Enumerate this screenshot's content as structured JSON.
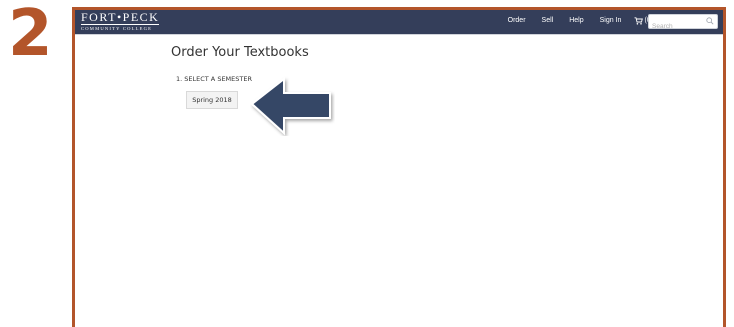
{
  "step": {
    "number": "2"
  },
  "header": {
    "logo": {
      "name": "FORT•PECK",
      "subtitle": "COMMUNITY COLLEGE"
    },
    "nav": [
      {
        "label": "Order"
      },
      {
        "label": "Sell"
      },
      {
        "label": "Help"
      },
      {
        "label": "Sign In"
      }
    ],
    "cart": {
      "label": "(0)",
      "icon": "cart-icon"
    },
    "search": {
      "placeholder": "Search",
      "icon": "search-icon"
    }
  },
  "main": {
    "title": "Order Your Textbooks",
    "step_label": "1. SELECT A SEMESTER",
    "semester_option": "Spring 2018"
  },
  "colors": {
    "frame_border": "#b3552a",
    "navbar": "#343e5a",
    "arrow": "#364766"
  }
}
